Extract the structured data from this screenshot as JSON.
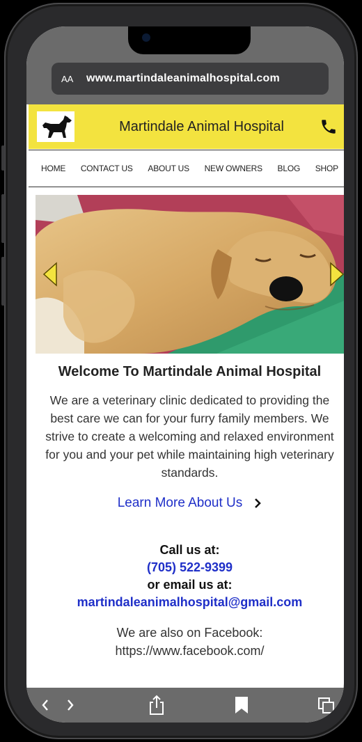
{
  "browser": {
    "text_size_label": "AA",
    "url": "www.martindaleanimalhospital.com"
  },
  "site": {
    "title": "Martindale Animal Hospital",
    "brand_color": "#f3e33f"
  },
  "nav": {
    "items": [
      "HOME",
      "CONTACT US",
      "ABOUT US",
      "NEW OWNERS",
      "BLOG",
      "SHOP"
    ]
  },
  "hero": {
    "arrow_color": "#f3e33f"
  },
  "main": {
    "heading": "Welcome To Martindale Animal Hospital",
    "intro": "We are a veterinary clinic dedicated to providing the best care we can for your furry family members. We strive to create a welcoming and relaxed environment for you and your pet while maintaining high veterinary standards.",
    "learn_more": "Learn More About Us",
    "call_label": "Call us at:",
    "phone": "(705) 522-9399",
    "email_label": "or email us at:",
    "email": "martindaleanimalhospital@gmail.com",
    "facebook_label": "We are also on Facebook:",
    "facebook_url": "https://www.facebook.com/"
  },
  "icons": {
    "phone": "phone-icon",
    "back": "chevron-left-icon",
    "forward": "chevron-right-icon",
    "share": "share-icon",
    "bookmarks": "bookmark-icon",
    "tabs": "tabs-icon"
  }
}
